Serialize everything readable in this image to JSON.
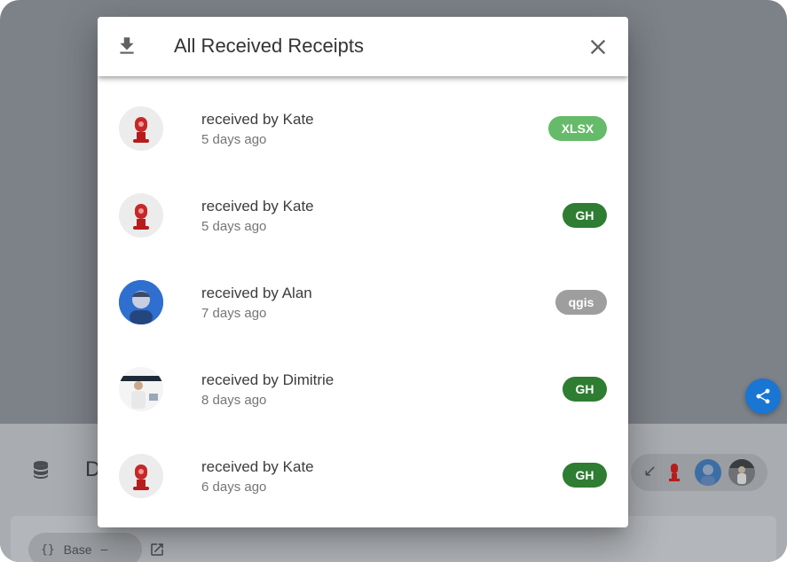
{
  "dialog": {
    "title": "All Received Receipts",
    "download_icon": "download-icon",
    "close_icon": "close-icon"
  },
  "receipts": [
    {
      "title": "received by Kate",
      "time": "5 days ago",
      "avatar": "robot-avatar",
      "app": "XLSX",
      "app_color": "#66bb6a"
    },
    {
      "title": "received by Kate",
      "time": "5 days ago",
      "avatar": "robot-avatar",
      "app": "GH",
      "app_color": "#2e7d32"
    },
    {
      "title": "received by Alan",
      "time": "7 days ago",
      "avatar": "photo-avatar",
      "app": "qgis",
      "app_color": "#9e9e9e"
    },
    {
      "title": "received by Dimitrie",
      "time": "8 days ago",
      "avatar": "photo-avatar",
      "app": "GH",
      "app_color": "#2e7d32"
    },
    {
      "title": "received by Kate",
      "time": "6 days ago",
      "avatar": "robot-avatar",
      "app": "GH",
      "app_color": "#2e7d32"
    }
  ],
  "background": {
    "stream_letter": "D",
    "branch_chip": {
      "braces": "{}",
      "label": "Base",
      "dash": "—"
    }
  },
  "colors": {
    "backdrop": "#7d8288",
    "share_fab": "#1976d2",
    "xlsx": "#66bb6a",
    "gh": "#2e7d32",
    "qgis": "#9e9e9e"
  }
}
